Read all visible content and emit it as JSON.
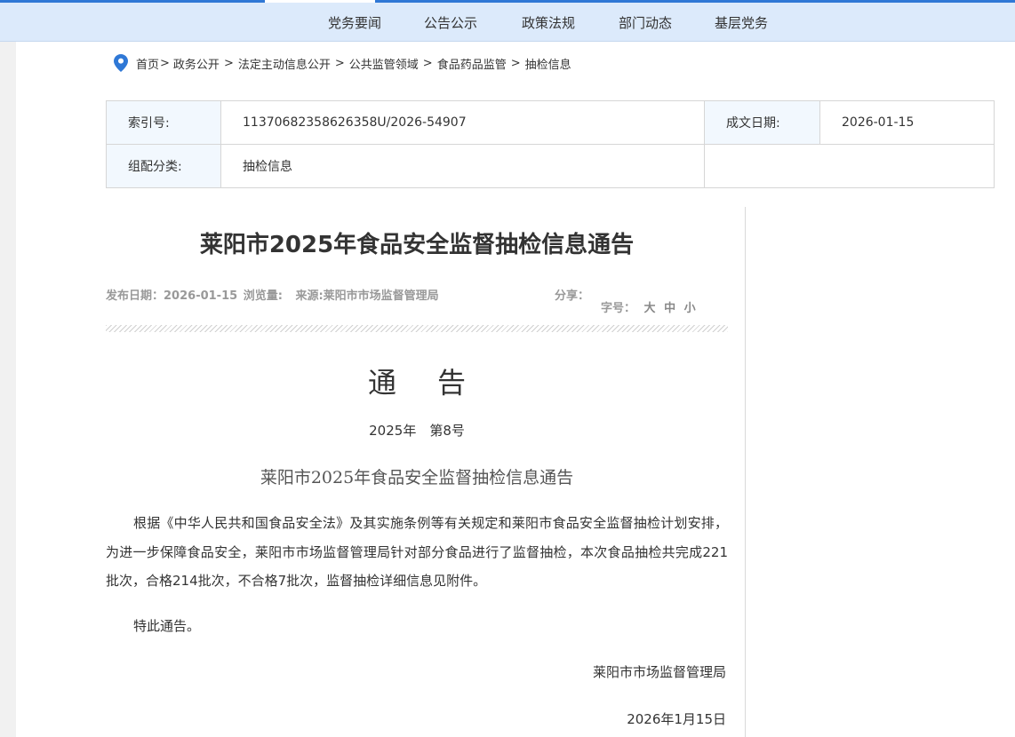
{
  "colors": {
    "accent": "#2f78d6",
    "nav_background": "#dceafb",
    "label_cell_background": "#f2f8fe",
    "muted_text": "#999999"
  },
  "nav": {
    "items": [
      {
        "label": "党务要闻"
      },
      {
        "label": "公告公示"
      },
      {
        "label": "政策法规"
      },
      {
        "label": "部门动态"
      },
      {
        "label": "基层党务"
      }
    ]
  },
  "breadcrumb": {
    "icon": "location-pin-icon",
    "items": [
      "首页",
      "政务公开",
      "法定主动信息公开",
      "公共监管领域",
      "食品药品监管",
      "抽检信息"
    ],
    "separator": ">"
  },
  "meta": {
    "index_label": "索引号:",
    "index_value": "11370682358626358U/2026-54907",
    "date_label": "成文日期:",
    "date_value": "2026-01-15",
    "category_label": "组配分类:",
    "category_value": "抽检信息"
  },
  "article": {
    "title": "莱阳市2025年食品安全监督抽检信息通告",
    "publish_label": "发布日期：",
    "publish_date": "2026-01-15",
    "views_label": "浏览量:",
    "source_label": "来源:",
    "source": "莱阳市市场监督管理局",
    "share_label": "分享：",
    "fontsize_label": "字号：",
    "fontsize_options": [
      "大",
      "中",
      "小"
    ],
    "notice_heading": "通告",
    "notice_number": "2025年　第8号",
    "notice_subtitle": "莱阳市2025年食品安全监督抽检信息通告",
    "body": "根据《中华人民共和国食品安全法》及其实施条例等有关规定和莱阳市食品安全监督抽检计划安排，为进一步保障食品安全，莱阳市市场监督管理局针对部分食品进行了监督抽检，本次食品抽检共完成221批次，合格214批次，不合格7批次，监督抽检详细信息见附件。",
    "closing": "特此通告。",
    "signer": "莱阳市市场监督管理局",
    "sign_date": "2026年1月15日"
  }
}
